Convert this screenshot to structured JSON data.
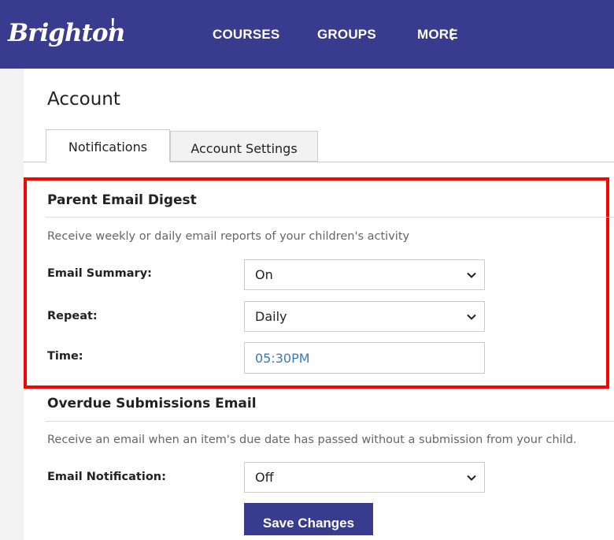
{
  "header": {
    "logo_text": "Brighton",
    "logo_mark": "!",
    "nav": {
      "courses": "COURSES",
      "groups": "GROUPS",
      "more": "MORE"
    },
    "bg_color": "#393b8e"
  },
  "page": {
    "title": "Account",
    "tabs": [
      {
        "label": "Notifications",
        "active": true
      },
      {
        "label": "Account Settings",
        "active": false
      }
    ]
  },
  "parent_digest": {
    "title": "Parent Email Digest",
    "description": "Receive weekly or daily email reports of your children's activity",
    "fields": {
      "email_summary": {
        "label": "Email Summary:",
        "value": "On"
      },
      "repeat": {
        "label": "Repeat:",
        "value": "Daily"
      },
      "time": {
        "label": "Time:",
        "value": "05:30PM"
      }
    }
  },
  "overdue": {
    "title": "Overdue Submissions Email",
    "description": "Receive an email when an item's due date has passed without a submission from your child.",
    "fields": {
      "email_notification": {
        "label": "Email Notification:",
        "value": "Off"
      }
    }
  },
  "actions": {
    "save_label": "Save Changes"
  },
  "colors": {
    "highlight": "#ff0000",
    "accent": "#393b8e"
  }
}
